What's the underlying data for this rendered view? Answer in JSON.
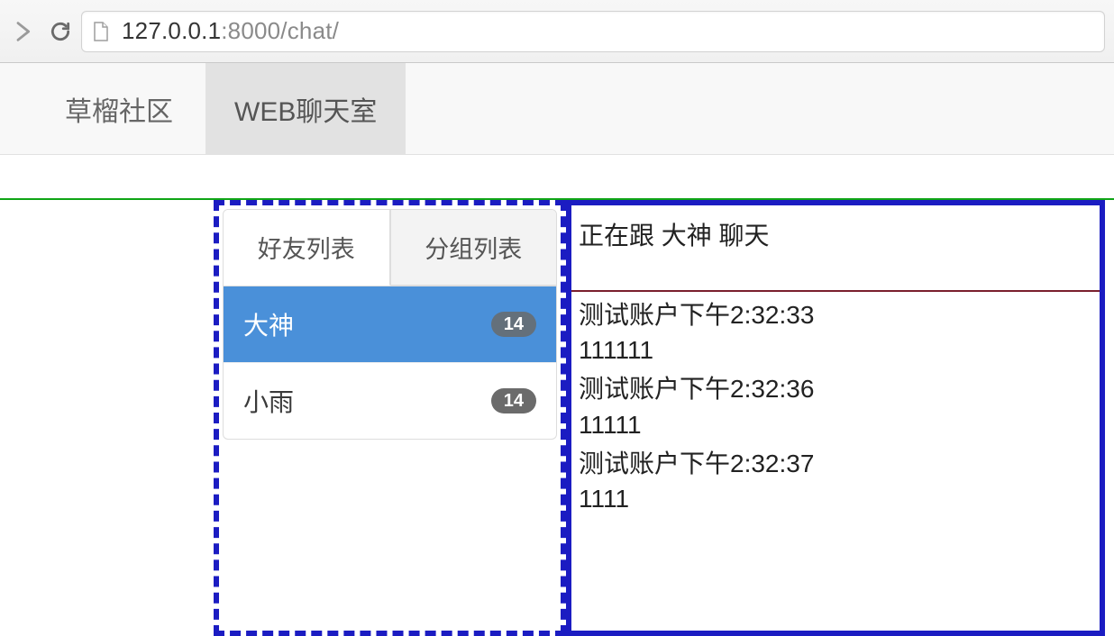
{
  "browser": {
    "url_host": "127.0.0.1",
    "url_port_path": ":8000/chat/"
  },
  "navbar": {
    "brand": "草榴社区",
    "active_item": "WEB聊天室"
  },
  "sidebar": {
    "tabs": {
      "friends": "好友列表",
      "groups": "分组列表"
    },
    "friends": [
      {
        "name": "大神",
        "badge": "14",
        "selected": true
      },
      {
        "name": "小雨",
        "badge": "14",
        "selected": false
      }
    ]
  },
  "chat": {
    "header": "正在跟 大神 聊天",
    "messages": [
      {
        "meta": "测试账户下午2:32:33",
        "body": "111111"
      },
      {
        "meta": "测试账户下午2:32:36",
        "body": "11111"
      },
      {
        "meta": "测试账户下午2:32:37",
        "body": "1111"
      }
    ]
  }
}
